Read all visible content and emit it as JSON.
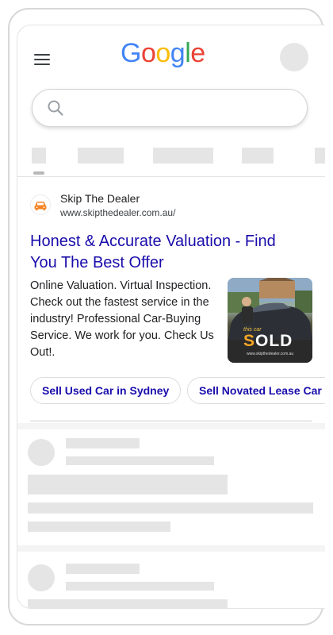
{
  "header": {
    "logo_letters": [
      {
        "char": "G",
        "color": "#4285F4"
      },
      {
        "char": "o",
        "color": "#EA4335"
      },
      {
        "char": "o",
        "color": "#FBBC05"
      },
      {
        "char": "g",
        "color": "#4285F4"
      },
      {
        "char": "l",
        "color": "#34A853"
      },
      {
        "char": "e",
        "color": "#EA4335"
      }
    ],
    "menu_icon": "hamburger-menu-icon",
    "avatar_icon": "account-avatar"
  },
  "search": {
    "value": "",
    "icon": "search-icon"
  },
  "ad": {
    "site_name": "Skip The Dealer",
    "url": "www.skipthedealer.com.au/",
    "title": "Honest & Accurate Valuation - Find You The Best Offer",
    "description": "Online Valuation. Virtual Inspection. Check out the fastest service in the industry! Professional Car-Buying Service. We work for you. Check Us Out!.",
    "thumbnail": {
      "small_text": "this car",
      "big_text": "SOLD",
      "caption": "www.skipthedealer.com.au"
    },
    "sitelinks": [
      "Sell Used Car in Sydney",
      "Sell Novated Lease Car"
    ]
  },
  "colors": {
    "link": "#1a0dab",
    "placeholder": "#e5e5e5",
    "brand_orange": "#f5a623"
  }
}
